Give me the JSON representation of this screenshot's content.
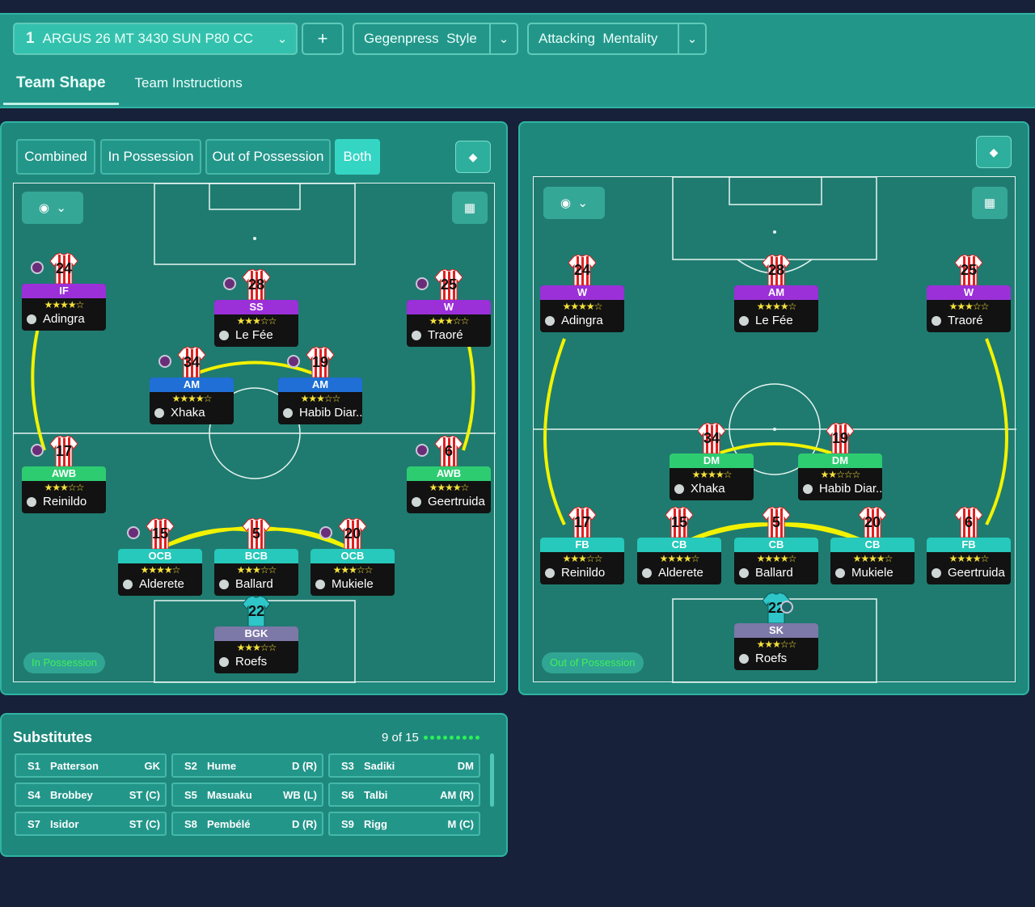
{
  "topbar": {
    "tactic_num": "1",
    "tactic_name": "ARGUS 26 MT 3430 SUN P80 CC",
    "add_label": "+",
    "style_word1": "Gegenpress",
    "style_word2": "Style",
    "mentality_word1": "Attacking",
    "mentality_word2": "Mentality"
  },
  "tabs": [
    {
      "label": "Team Shape"
    },
    {
      "label": "Team Instructions"
    }
  ],
  "view_buttons": [
    "Combined",
    "In Possession",
    "Out of Possession",
    "Both"
  ],
  "pitch_left": {
    "mode_label": "In Possession"
  },
  "pitch_right": {
    "mode_label": "Out of Possession"
  },
  "players_left": [
    {
      "num": "24",
      "role": "IF",
      "stars": "★★★★☆",
      "name": "Adingra",
      "color": "#9b30d9"
    },
    {
      "num": "28",
      "role": "SS",
      "stars": "★★★☆☆",
      "name": "Le Fée",
      "color": "#9b30d9"
    },
    {
      "num": "25",
      "role": "W",
      "stars": "★★★☆☆",
      "name": "Traoré",
      "color": "#9b30d9"
    },
    {
      "num": "34",
      "role": "AM",
      "stars": "★★★★☆",
      "name": "Xhaka",
      "color": "#1f6fd6"
    },
    {
      "num": "19",
      "role": "AM",
      "stars": "★★★☆☆",
      "name": "Habib Diar...",
      "color": "#1f6fd6"
    },
    {
      "num": "17",
      "role": "AWB",
      "stars": "★★★☆☆",
      "name": "Reinildo",
      "color": "#2ecc71"
    },
    {
      "num": "6",
      "role": "AWB",
      "stars": "★★★★☆",
      "name": "Geertruida",
      "color": "#2ecc71"
    },
    {
      "num": "15",
      "role": "OCB",
      "stars": "★★★★☆",
      "name": "Alderete",
      "color": "#26c9bb"
    },
    {
      "num": "5",
      "role": "BCB",
      "stars": "★★★☆☆",
      "name": "Ballard",
      "color": "#26c9bb"
    },
    {
      "num": "20",
      "role": "OCB",
      "stars": "★★★☆☆",
      "name": "Mukiele",
      "color": "#26c9bb"
    },
    {
      "num": "22",
      "role": "BGK",
      "stars": "★★★☆☆",
      "name": "Roefs",
      "color": "#7c78a8"
    }
  ],
  "players_right": [
    {
      "num": "24",
      "role": "W",
      "stars": "★★★★☆",
      "name": "Adingra",
      "color": "#9b30d9"
    },
    {
      "num": "28",
      "role": "AM",
      "stars": "★★★★☆",
      "name": "Le Fée",
      "color": "#9b30d9"
    },
    {
      "num": "25",
      "role": "W",
      "stars": "★★★☆☆",
      "name": "Traoré",
      "color": "#9b30d9"
    },
    {
      "num": "34",
      "role": "DM",
      "stars": "★★★★☆",
      "name": "Xhaka",
      "color": "#2ecc71"
    },
    {
      "num": "19",
      "role": "DM",
      "stars": "★★☆☆☆",
      "name": "Habib Diar...",
      "color": "#2ecc71"
    },
    {
      "num": "17",
      "role": "FB",
      "stars": "★★★☆☆",
      "name": "Reinildo",
      "color": "#26c9bb"
    },
    {
      "num": "15",
      "role": "CB",
      "stars": "★★★★☆",
      "name": "Alderete",
      "color": "#26c9bb"
    },
    {
      "num": "5",
      "role": "CB",
      "stars": "★★★★☆",
      "name": "Ballard",
      "color": "#26c9bb"
    },
    {
      "num": "20",
      "role": "CB",
      "stars": "★★★★☆",
      "name": "Mukiele",
      "color": "#26c9bb"
    },
    {
      "num": "6",
      "role": "FB",
      "stars": "★★★★☆",
      "name": "Geertruida",
      "color": "#26c9bb"
    },
    {
      "num": "22",
      "role": "SK",
      "stars": "★★★☆☆",
      "name": "Roefs",
      "color": "#7c78a8"
    }
  ],
  "substitutes": {
    "title": "Substitutes",
    "count": "9 of 15",
    "items": [
      {
        "slot": "S1",
        "name": "Patterson",
        "pos": "GK"
      },
      {
        "slot": "S2",
        "name": "Hume",
        "pos": "D (R)"
      },
      {
        "slot": "S3",
        "name": "Sadiki",
        "pos": "DM"
      },
      {
        "slot": "S4",
        "name": "Brobbey",
        "pos": "ST (C)"
      },
      {
        "slot": "S5",
        "name": "Masuaku",
        "pos": "WB (L)"
      },
      {
        "slot": "S6",
        "name": "Talbi",
        "pos": "AM (R)"
      },
      {
        "slot": "S7",
        "name": "Isidor",
        "pos": "ST (C)"
      },
      {
        "slot": "S8",
        "name": "Pembélé",
        "pos": "D (R)"
      },
      {
        "slot": "S9",
        "name": "Rigg",
        "pos": "M (C)"
      }
    ]
  }
}
